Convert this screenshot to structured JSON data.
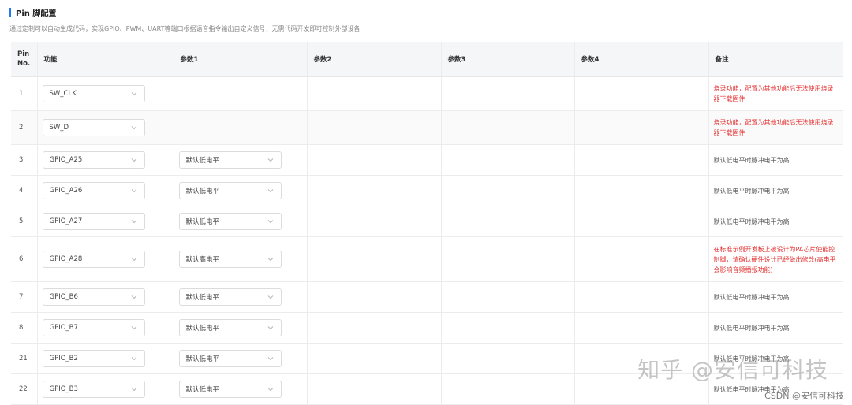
{
  "header": {
    "title": "Pin 脚配置",
    "description": "通过定制可以自动生成代码，实现GPIO、PWM、UART等端口根据语音指令输出自定义信号，无需代码开发即可控制外部设备"
  },
  "table": {
    "columns": [
      "Pin No.",
      "功能",
      "参数1",
      "参数2",
      "参数3",
      "参数4",
      "备注"
    ],
    "rows": [
      {
        "pin": "1",
        "func": "SW_CLK",
        "param1": "",
        "note": "烧录功能，配置为其他功能后无法使用烧录器下载固件",
        "warn": true
      },
      {
        "pin": "2",
        "func": "SW_D",
        "param1": "",
        "note": "烧录功能，配置为其他功能后无法使用烧录器下载固件",
        "warn": true
      },
      {
        "pin": "3",
        "func": "GPIO_A25",
        "param1": "默认低电平",
        "note": "默认低电平时脉冲电平为高",
        "warn": false
      },
      {
        "pin": "4",
        "func": "GPIO_A26",
        "param1": "默认低电平",
        "note": "默认低电平时脉冲电平为高",
        "warn": false
      },
      {
        "pin": "5",
        "func": "GPIO_A27",
        "param1": "默认低电平",
        "note": "默认低电平时脉冲电平为高",
        "warn": false
      },
      {
        "pin": "6",
        "func": "GPIO_A28",
        "param1": "默认高电平",
        "note": "在标准示例开发板上被设计为PA芯片使能控制脚，请确认硬件设计已经做出修改(高电平会影响音频播报功能)",
        "warn": true
      },
      {
        "pin": "7",
        "func": "GPIO_B6",
        "param1": "默认低电平",
        "note": "默认低电平时脉冲电平为高",
        "warn": false
      },
      {
        "pin": "8",
        "func": "GPIO_B7",
        "param1": "默认低电平",
        "note": "默认低电平时脉冲电平为高",
        "warn": false
      },
      {
        "pin": "21",
        "func": "GPIO_B2",
        "param1": "默认低电平",
        "note": "默认低电平时脉冲电平为高",
        "warn": false
      },
      {
        "pin": "22",
        "func": "GPIO_B3",
        "param1": "默认低电平",
        "note": "默认低电平时脉冲电平为高",
        "warn": false
      }
    ]
  },
  "watermark": {
    "main": "知乎 @安信可科技",
    "sub": "CSDN @安信可科技"
  },
  "colors": {
    "accent": "#1e7bf0",
    "warning": "#e53333"
  }
}
